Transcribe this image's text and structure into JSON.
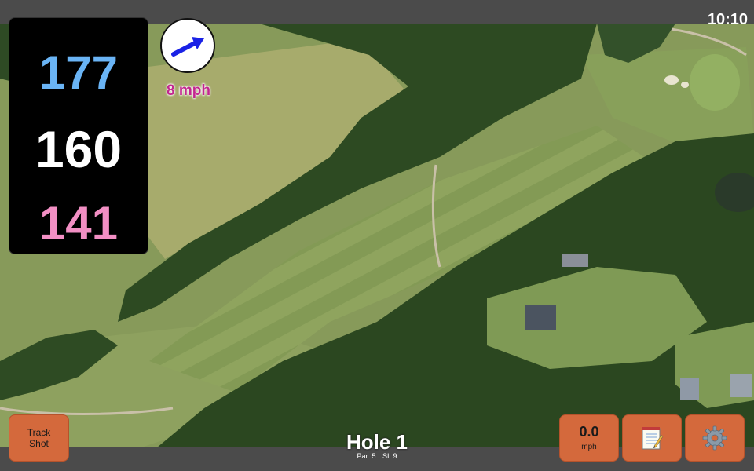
{
  "status_bar": {
    "time": "10:10"
  },
  "distances": {
    "back": "177",
    "middle": "160",
    "front": "141",
    "colors": {
      "back": "#6ab4f5",
      "middle": "#ffffff",
      "front": "#f28fc4"
    }
  },
  "wind": {
    "speed_label": "8 mph",
    "arrow_color": "#1a22e6",
    "label_color": "#c2278f"
  },
  "buttons": {
    "track_shot": {
      "line1": "Track",
      "line2": "Shot"
    },
    "speed": {
      "value": "0.0",
      "unit": "mph"
    },
    "notes_icon": "notepad-icon",
    "settings_icon": "gear-icon"
  },
  "hole": {
    "title": "Hole 1",
    "par": "Par: 5",
    "si": "SI: 9"
  },
  "theme": {
    "button_color": "#d4693c",
    "bar_color": "#4b4b4b"
  }
}
